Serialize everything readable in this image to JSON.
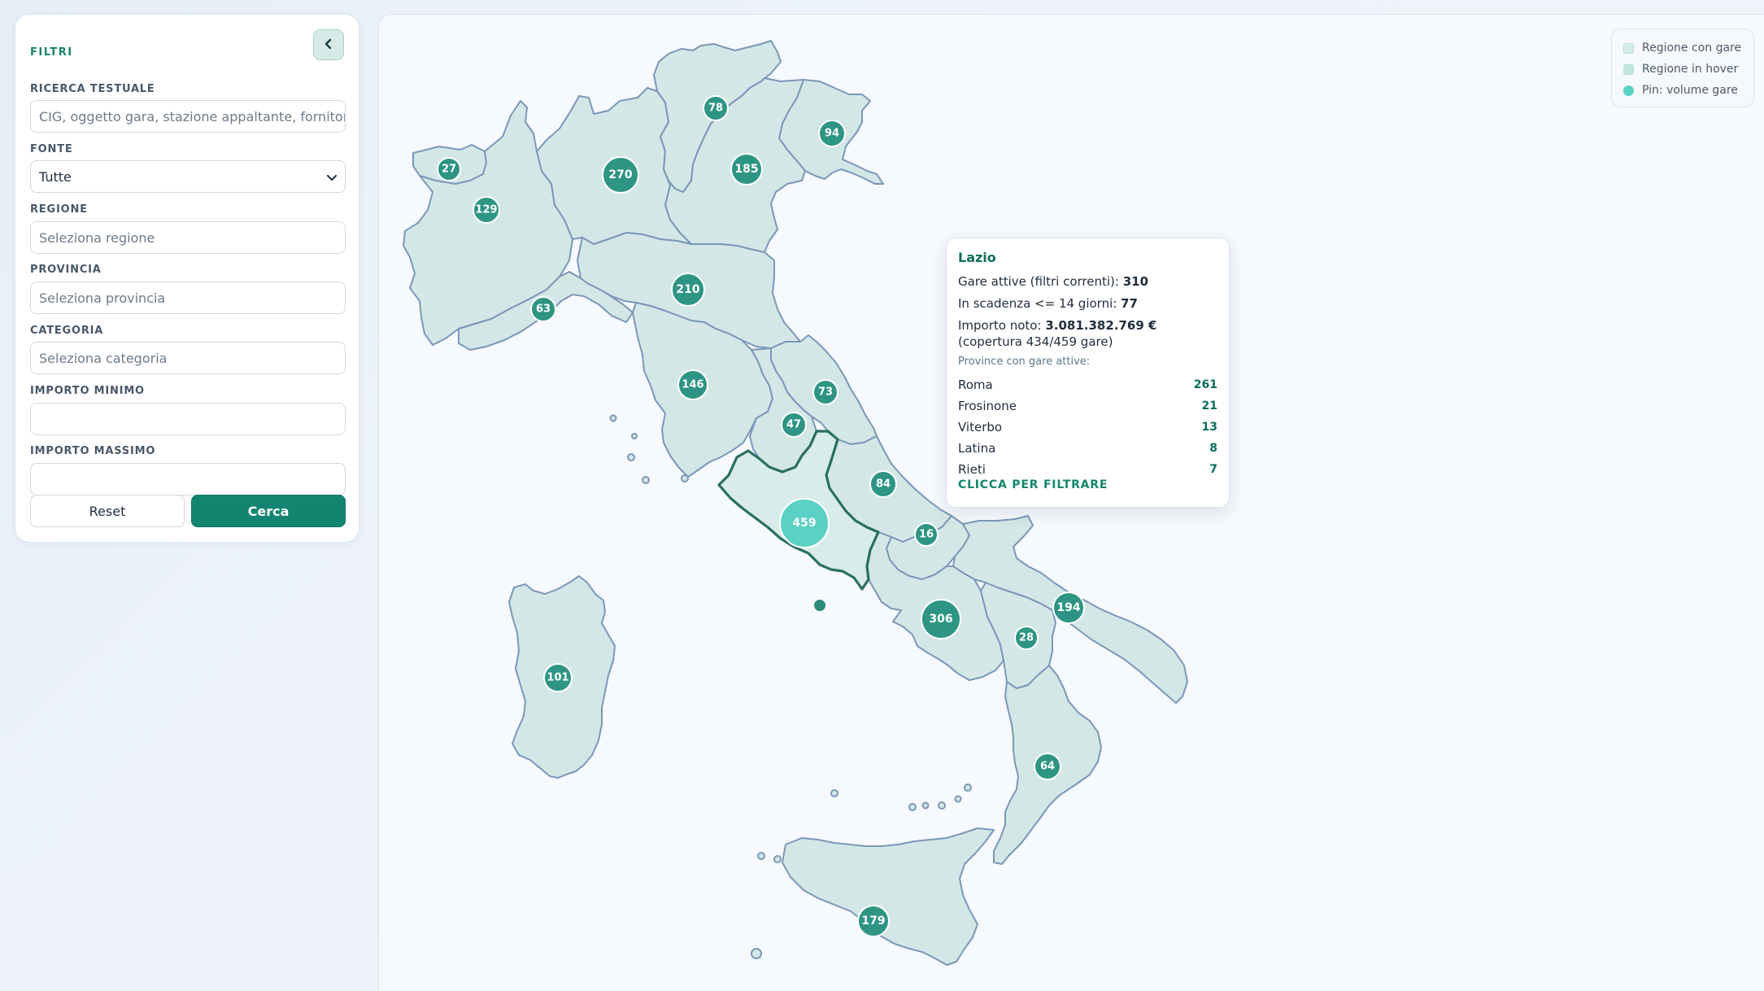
{
  "sidebar": {
    "title": "FILTRI",
    "collapse_icon": "chevron-left-icon",
    "fields": [
      {
        "label": "RICERCA TESTUALE",
        "placeholder": "CIG, oggetto gara, stazione appaltante, fornitore...",
        "value": ""
      },
      {
        "label": "FONTE",
        "value": "Tutte"
      },
      {
        "label": "REGIONE",
        "placeholder": "Seleziona regione",
        "value": ""
      },
      {
        "label": "PROVINCIA",
        "placeholder": "Seleziona provincia",
        "value": ""
      },
      {
        "label": "CATEGORIA",
        "placeholder": "Seleziona categoria",
        "value": ""
      },
      {
        "label": "IMPORTO MINIMO",
        "placeholder": "",
        "value": ""
      },
      {
        "label": "IMPORTO MASSIMO",
        "placeholder": "",
        "value": ""
      }
    ],
    "reset_label": "Reset",
    "search_label": "Cerca"
  },
  "legend": {
    "items": [
      {
        "label": "Regione con gare",
        "color": "#d3ecea"
      },
      {
        "label": "Regione in hover",
        "color": "#bfe6e0"
      },
      {
        "label": "Pin: volume gare",
        "color": "#5ad1c4"
      }
    ]
  },
  "map": {
    "region_fill": "#d3e8e6",
    "region_stroke": "#7b97b8",
    "hover_stroke": "#1f6e5f",
    "pin_color": "#2e9584",
    "pin_highlight": "#5ad1c4",
    "pins": [
      {
        "value": "27"
      },
      {
        "value": "129"
      },
      {
        "value": "270"
      },
      {
        "value": "78"
      },
      {
        "value": "185"
      },
      {
        "value": "94"
      },
      {
        "value": "63"
      },
      {
        "value": "210"
      },
      {
        "value": "146"
      },
      {
        "value": "73"
      },
      {
        "value": "47"
      },
      {
        "value": "84"
      },
      {
        "value": "459"
      },
      {
        "value": "16"
      },
      {
        "value": "306"
      },
      {
        "value": "194"
      },
      {
        "value": "28"
      },
      {
        "value": "101"
      },
      {
        "value": "64"
      },
      {
        "value": "179"
      }
    ]
  },
  "tooltip": {
    "title": "Lazio",
    "active_label": "Gare attive (filtri correnti):",
    "active_value": "310",
    "expiring_label": "In scadenza <= 14 giorni:",
    "expiring_value": "77",
    "amount_label": "Importo noto:",
    "amount_value": "3.081.382.769 €",
    "coverage_text": "(copertura 434/459 gare)",
    "provinces_label": "Province con gare attive:",
    "provinces": [
      {
        "name": "Roma",
        "count": "261"
      },
      {
        "name": "Frosinone",
        "count": "21"
      },
      {
        "name": "Viterbo",
        "count": "13"
      },
      {
        "name": "Latina",
        "count": "8"
      },
      {
        "name": "Rieti",
        "count": "7"
      }
    ],
    "cta": "CLICCA PER FILTRARE"
  }
}
